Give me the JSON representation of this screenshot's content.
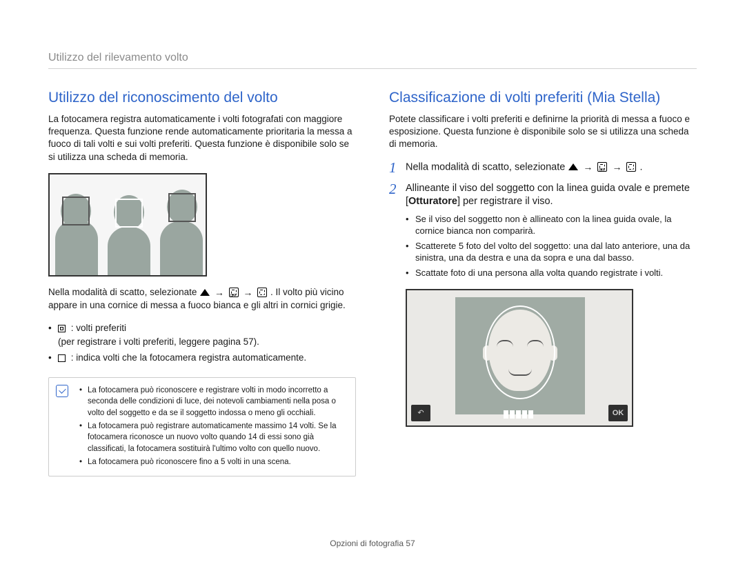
{
  "header": {
    "title": "Utilizzo del rilevamento volto"
  },
  "left": {
    "section_title": "Utilizzo del riconoscimento del volto",
    "intro": "La fotocamera registra automaticamente i volti fotografati con maggiore frequenza. Questa funzione rende automaticamente prioritaria la messa a fuoco di tali volti e sui volti preferiti. Questa funzione è disponibile solo se si utilizza una scheda di memoria.",
    "mode_instructions_pre": "Nella modalità di scatto, selezionate ",
    "mode_instructions_post": ". Il volto più vicino appare in una cornice di messa a fuoco bianca e gli altri in cornici grigie.",
    "bullets": {
      "b1": ": volti preferiti",
      "b1_sub": "(per registrare i volti preferiti, leggere pagina 57).",
      "b2": ": indica volti che la fotocamera registra automaticamente."
    },
    "notes": {
      "n1": "La fotocamera può riconoscere e registrare volti in modo incorretto a seconda delle condizioni di luce, dei notevoli cambiamenti nella posa o volto del soggetto e da se il soggetto indossa o meno gli occhiali.",
      "n2": "La fotocamera può registrare automaticamente massimo 14 volti. Se la fotocamera riconosce un nuovo volto quando 14 di essi sono già classificati, la fotocamera sostituirà l'ultimo volto con quello nuovo.",
      "n3": "La fotocamera può riconoscere fino a 5 volti in una scena."
    }
  },
  "right": {
    "section_title": "Classificazione di volti preferiti (Mia Stella)",
    "intro": "Potete classificare i volti preferiti e definirne la priorità di messa a fuoco e esposizione. Questa funzione è disponibile solo se si utilizza una scheda di memoria.",
    "steps": {
      "s1_num": "1",
      "s1_pre": "Nella modalità di scatto, selezionate ",
      "s1_post": ".",
      "s2_num": "2",
      "s2_line": "Allineante il viso del soggetto con la linea guida ovale e premete [",
      "s2_bold": "Otturatore",
      "s2_end": "] per registrare il viso.",
      "s2_b1": "Se il viso del soggetto non è allineato con la linea guida ovale, la cornice bianca non comparirà.",
      "s2_b2": "Scatterete 5 foto del volto del soggetto: una dal lato anteriore, una da sinistra, una da destra e una da sopra e una dal basso.",
      "s2_b3": "Scattate foto di una persona alla volta quando registrate i volti."
    },
    "ok_label": "OK"
  },
  "footer": {
    "text_pre": "Opzioni di fotografia  ",
    "page_num": "57"
  }
}
